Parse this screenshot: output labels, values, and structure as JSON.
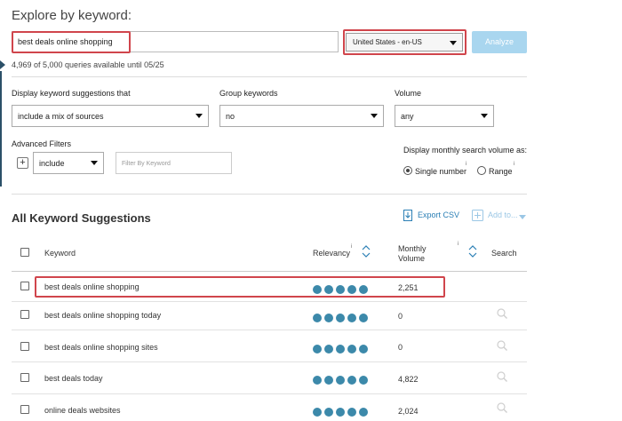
{
  "heading": "Explore by keyword:",
  "search": {
    "value": "best deals online shopping"
  },
  "locale": {
    "value": "United States - en-US"
  },
  "analyze_label": "Analyze",
  "queries_info": "4,969 of 5,000 queries available until 05/25",
  "filters": {
    "suggestions_label": "Display keyword suggestions that",
    "suggestions_value": "include a mix of sources",
    "group_label": "Group keywords",
    "group_value": "no",
    "volume_label": "Volume",
    "volume_value": "any",
    "advanced_label": "Advanced Filters",
    "include_value": "include",
    "filter_placeholder": "Filter By Keyword",
    "monthly_label": "Display monthly search volume as:",
    "single_label": "Single number",
    "range_label": "Range"
  },
  "section_title": "All Keyword Suggestions",
  "export_label": "Export CSV",
  "addto_label": "Add to...",
  "table": {
    "headers": {
      "keyword": "Keyword",
      "relevancy": "Relevancy",
      "volume_line1": "Monthly",
      "volume_line2": "Volume",
      "search": "Search"
    },
    "rows": [
      {
        "keyword": "best deals online shopping",
        "relevancy": 5,
        "volume": "2,251"
      },
      {
        "keyword": "best deals online shopping today",
        "relevancy": 5,
        "volume": "0"
      },
      {
        "keyword": "best deals online shopping sites",
        "relevancy": 5,
        "volume": "0"
      },
      {
        "keyword": "best deals today",
        "relevancy": 5,
        "volume": "4,822"
      },
      {
        "keyword": "online deals websites",
        "relevancy": 5,
        "volume": "2,024"
      }
    ]
  },
  "colors": {
    "accent": "#2b7fb5",
    "highlight": "#d0454c",
    "dot": "#3c89aa",
    "analyze_bg": "#a9d6ef"
  }
}
